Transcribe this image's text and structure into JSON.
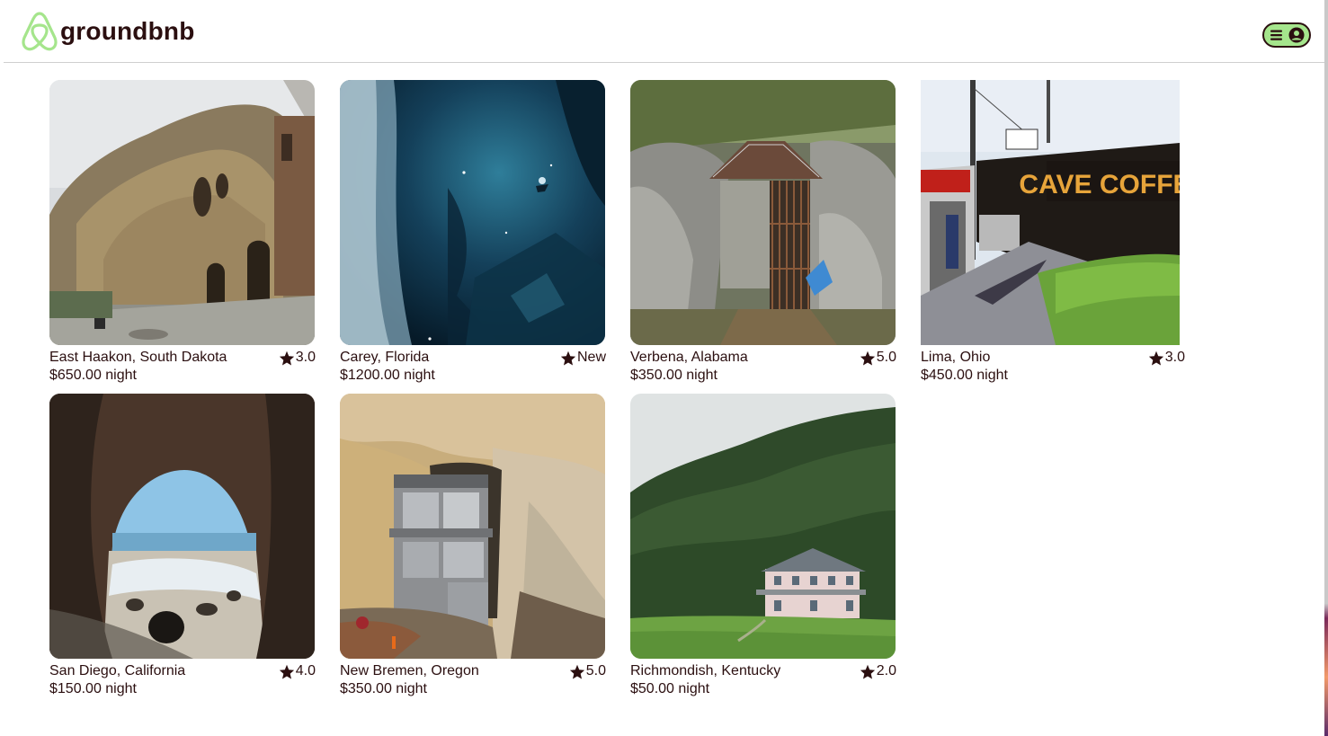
{
  "header": {
    "brand": "groundbnb",
    "brand_color": "#2b0f10",
    "accent_color": "#a5e58c",
    "logo_icon": "airbnb-style-logo-icon",
    "menu_icons": [
      "hamburger-icon",
      "user-avatar-icon"
    ]
  },
  "listings": [
    {
      "location": "East Haakon, South Dakota",
      "rating": "3.0",
      "price": "$650.00 night",
      "image": "sandstone-cave-dwelling"
    },
    {
      "location": "Carey, Florida",
      "rating": "New",
      "price": "$1200.00 night",
      "image": "underwater-cave-diver"
    },
    {
      "location": "Verbena, Alabama",
      "rating": "5.0",
      "price": "$350.00 night",
      "image": "gated-cave-entrance"
    },
    {
      "location": "Lima, Ohio",
      "rating": "3.0",
      "price": "$450.00 night",
      "image": "cave-coffee-storefront",
      "sign_text": "CAVE COFFEE"
    },
    {
      "location": "San Diego, California",
      "rating": "4.0",
      "price": "$150.00 night",
      "image": "sea-cave-beach"
    },
    {
      "location": "New Bremen, Oregon",
      "rating": "5.0",
      "price": "$350.00 night",
      "image": "house-built-in-cliff"
    },
    {
      "location": "Richmondish, Kentucky",
      "rating": "2.0",
      "price": "$50.00 night",
      "image": "farmhouse-by-forest"
    }
  ]
}
